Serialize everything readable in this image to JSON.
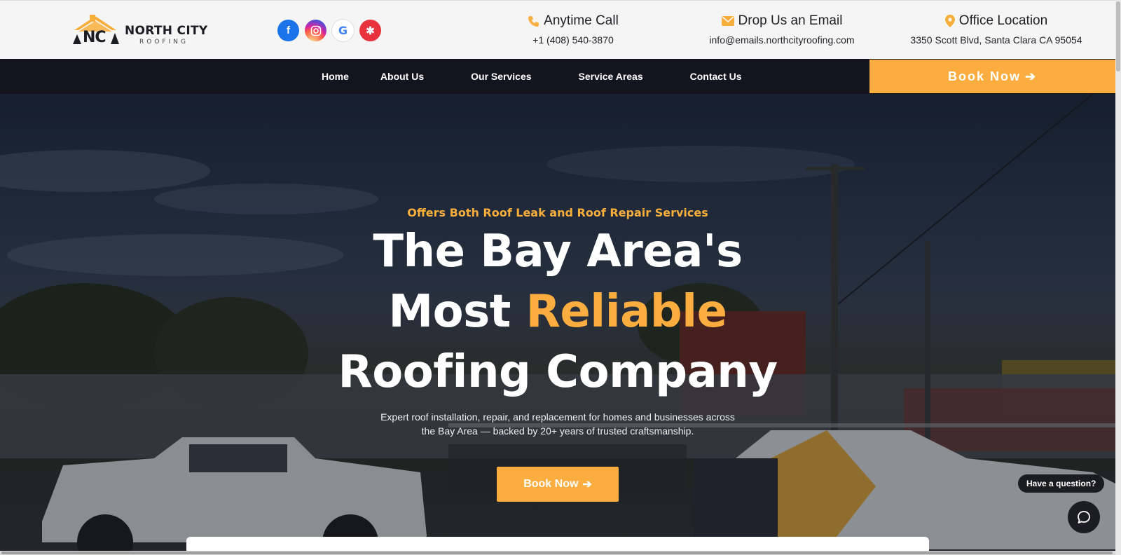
{
  "logo": {
    "name": "NORTH CITY",
    "sub": "ROOFING",
    "monogram": "NC",
    "icon": "house-logo-icon"
  },
  "socials": [
    {
      "name": "facebook-icon",
      "glyph": "f"
    },
    {
      "name": "instagram-icon",
      "glyph": "◎"
    },
    {
      "name": "google-icon",
      "glyph": "G"
    },
    {
      "name": "yelp-icon",
      "glyph": "✱"
    }
  ],
  "contacts": {
    "call": {
      "title": "Anytime Call",
      "value": "+1 (408) 540-3870",
      "icon": "phone-icon"
    },
    "email": {
      "title": "Drop Us an Email",
      "value": "info@emails.northcityroofing.com",
      "icon": "envelope-icon"
    },
    "location": {
      "title": "Office Location",
      "value": "3350 Scott Blvd, Santa Clara CA 95054",
      "icon": "map-pin-icon"
    }
  },
  "nav": {
    "items": [
      "Home",
      "About Us",
      "Our Services",
      "Service Areas",
      "Contact Us"
    ],
    "book_label": "Book Now",
    "arrow": "➔"
  },
  "hero": {
    "tagline": "Offers Both Roof Leak and Roof Repair Services",
    "headline_line1": "The Bay Area's",
    "headline_line2_a": "Most ",
    "headline_line2_b": "Reliable",
    "headline_line3": "Roofing Company",
    "description_line1": "Expert roof installation, repair, and replacement for homes and businesses across",
    "description_line2": "the Bay Area — backed by 20+ years of trusted craftsmanship.",
    "book_label": "Book Now",
    "arrow": "➔"
  },
  "chat": {
    "bubble": "Have a question?",
    "icon": "chat-icon"
  },
  "colors": {
    "accent": "#fbad3f",
    "nav_bg": "#14141f",
    "topbar_bg": "#f5f5f5"
  }
}
